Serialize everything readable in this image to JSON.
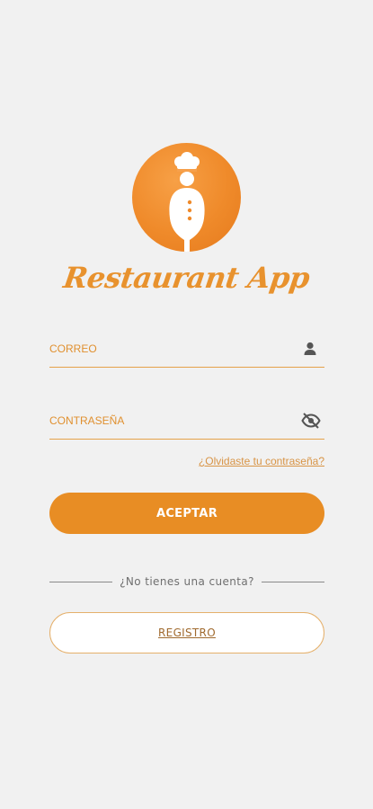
{
  "app": {
    "title": "Restaurant App"
  },
  "login": {
    "email_placeholder": "CORREO",
    "email_value": "",
    "password_placeholder": "CONTRASEÑA",
    "password_value": "",
    "forgot_label": "¿Olvidaste tu contraseña?",
    "accept_label": "ACEPTAR",
    "no_account_text": "¿No tienes una cuenta?",
    "register_label": "REGISTRO"
  },
  "icons": {
    "logo": "chef-spoon-logo-icon",
    "email": "user-icon",
    "password": "eye-off-icon"
  },
  "colors": {
    "brand_orange": "#e88d24",
    "background": "#f1f1f1",
    "field_underline": "#e5a24a"
  }
}
